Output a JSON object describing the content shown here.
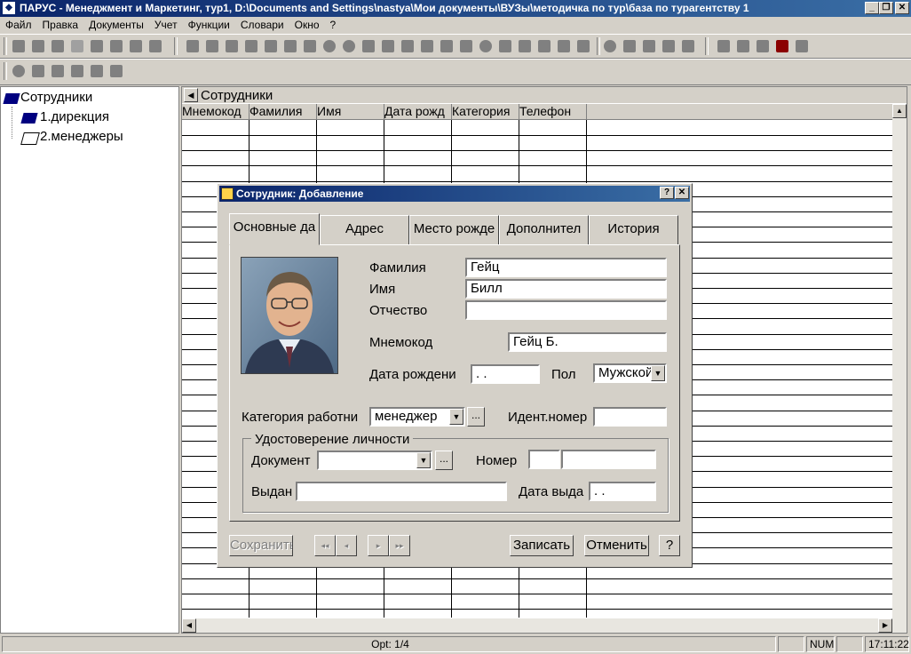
{
  "window": {
    "title": "ПАРУС - Менеджмент и Маркетинг, тур1, D:\\Documents and Settings\\nastya\\Мои документы\\ВУЗы\\методичка по тур\\база по турагентству 1",
    "minimize": "_",
    "restore": "❐",
    "close": "✕"
  },
  "menu": {
    "items": [
      "Файл",
      "Правка",
      "Документы",
      "Учет",
      "Функции",
      "Словари",
      "Окно",
      "?"
    ]
  },
  "tree": {
    "root": "Сотрудники",
    "children": [
      "1.дирекция",
      "2.менеджеры"
    ]
  },
  "grid": {
    "title": "Сотрудники",
    "columns": [
      "Мнемокод",
      "Фамилия",
      "Имя",
      "Дата рожд",
      "Категория",
      "Телефон"
    ]
  },
  "status": {
    "record": "Opt: 1/4",
    "num": "NUM",
    "time": "17:11:22"
  },
  "dialog": {
    "title": "Сотрудник: Добавление",
    "help_btn": "?",
    "close_btn": "✕",
    "tabs": [
      "Основные да",
      "Адрес",
      "Место рожде",
      "Дополнител",
      "История"
    ],
    "labels": {
      "surname": "Фамилия",
      "name": "Имя",
      "patronymic": "Отчество",
      "mnemo": "Мнемокод",
      "birthdate": "Дата рождени",
      "sex": "Пол",
      "category": "Категория работни",
      "ident": "Идент.номер",
      "id_group": "Удостоверение личности",
      "document": "Документ",
      "number": "Номер",
      "issued": "Выдан",
      "issue_date": "Дата выда"
    },
    "values": {
      "surname": "Гейц",
      "name": "Билл",
      "patronymic": "",
      "mnemo": "Гейц Б.",
      "birthdate": " .  .",
      "sex": "Мужской",
      "category": "менеджер",
      "ident": "",
      "document": "",
      "number_series": "",
      "number": "",
      "issued": "",
      "issue_date": " .  ."
    },
    "buttons": {
      "save": "Сохранить",
      "first": "◂◂",
      "prev": "◂",
      "next": "▸",
      "last": "▸▸",
      "write": "Записать",
      "cancel": "Отменить",
      "help": "?"
    }
  }
}
